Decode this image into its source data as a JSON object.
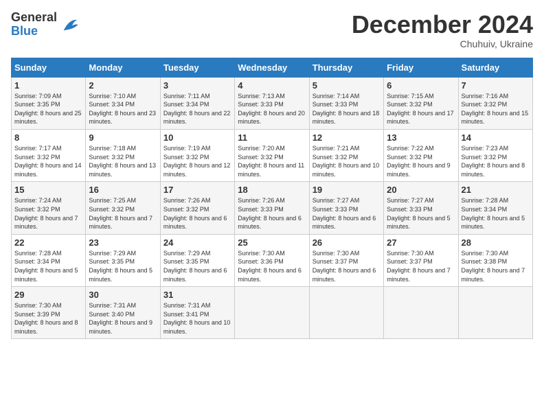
{
  "logo": {
    "general": "General",
    "blue": "Blue"
  },
  "header": {
    "title": "December 2024",
    "subtitle": "Chuhuiv, Ukraine"
  },
  "columns": [
    "Sunday",
    "Monday",
    "Tuesday",
    "Wednesday",
    "Thursday",
    "Friday",
    "Saturday"
  ],
  "weeks": [
    [
      {
        "day": "1",
        "sunrise": "7:09 AM",
        "sunset": "3:35 PM",
        "daylight": "8 hours and 25 minutes."
      },
      {
        "day": "2",
        "sunrise": "7:10 AM",
        "sunset": "3:34 PM",
        "daylight": "8 hours and 23 minutes."
      },
      {
        "day": "3",
        "sunrise": "7:11 AM",
        "sunset": "3:34 PM",
        "daylight": "8 hours and 22 minutes."
      },
      {
        "day": "4",
        "sunrise": "7:13 AM",
        "sunset": "3:33 PM",
        "daylight": "8 hours and 20 minutes."
      },
      {
        "day": "5",
        "sunrise": "7:14 AM",
        "sunset": "3:33 PM",
        "daylight": "8 hours and 18 minutes."
      },
      {
        "day": "6",
        "sunrise": "7:15 AM",
        "sunset": "3:32 PM",
        "daylight": "8 hours and 17 minutes."
      },
      {
        "day": "7",
        "sunrise": "7:16 AM",
        "sunset": "3:32 PM",
        "daylight": "8 hours and 15 minutes."
      }
    ],
    [
      {
        "day": "8",
        "sunrise": "7:17 AM",
        "sunset": "3:32 PM",
        "daylight": "8 hours and 14 minutes."
      },
      {
        "day": "9",
        "sunrise": "7:18 AM",
        "sunset": "3:32 PM",
        "daylight": "8 hours and 13 minutes."
      },
      {
        "day": "10",
        "sunrise": "7:19 AM",
        "sunset": "3:32 PM",
        "daylight": "8 hours and 12 minutes."
      },
      {
        "day": "11",
        "sunrise": "7:20 AM",
        "sunset": "3:32 PM",
        "daylight": "8 hours and 11 minutes."
      },
      {
        "day": "12",
        "sunrise": "7:21 AM",
        "sunset": "3:32 PM",
        "daylight": "8 hours and 10 minutes."
      },
      {
        "day": "13",
        "sunrise": "7:22 AM",
        "sunset": "3:32 PM",
        "daylight": "8 hours and 9 minutes."
      },
      {
        "day": "14",
        "sunrise": "7:23 AM",
        "sunset": "3:32 PM",
        "daylight": "8 hours and 8 minutes."
      }
    ],
    [
      {
        "day": "15",
        "sunrise": "7:24 AM",
        "sunset": "3:32 PM",
        "daylight": "8 hours and 7 minutes."
      },
      {
        "day": "16",
        "sunrise": "7:25 AM",
        "sunset": "3:32 PM",
        "daylight": "8 hours and 7 minutes."
      },
      {
        "day": "17",
        "sunrise": "7:26 AM",
        "sunset": "3:32 PM",
        "daylight": "8 hours and 6 minutes."
      },
      {
        "day": "18",
        "sunrise": "7:26 AM",
        "sunset": "3:33 PM",
        "daylight": "8 hours and 6 minutes."
      },
      {
        "day": "19",
        "sunrise": "7:27 AM",
        "sunset": "3:33 PM",
        "daylight": "8 hours and 6 minutes."
      },
      {
        "day": "20",
        "sunrise": "7:27 AM",
        "sunset": "3:33 PM",
        "daylight": "8 hours and 5 minutes."
      },
      {
        "day": "21",
        "sunrise": "7:28 AM",
        "sunset": "3:34 PM",
        "daylight": "8 hours and 5 minutes."
      }
    ],
    [
      {
        "day": "22",
        "sunrise": "7:28 AM",
        "sunset": "3:34 PM",
        "daylight": "8 hours and 5 minutes."
      },
      {
        "day": "23",
        "sunrise": "7:29 AM",
        "sunset": "3:35 PM",
        "daylight": "8 hours and 5 minutes."
      },
      {
        "day": "24",
        "sunrise": "7:29 AM",
        "sunset": "3:35 PM",
        "daylight": "8 hours and 6 minutes."
      },
      {
        "day": "25",
        "sunrise": "7:30 AM",
        "sunset": "3:36 PM",
        "daylight": "8 hours and 6 minutes."
      },
      {
        "day": "26",
        "sunrise": "7:30 AM",
        "sunset": "3:37 PM",
        "daylight": "8 hours and 6 minutes."
      },
      {
        "day": "27",
        "sunrise": "7:30 AM",
        "sunset": "3:37 PM",
        "daylight": "8 hours and 7 minutes."
      },
      {
        "day": "28",
        "sunrise": "7:30 AM",
        "sunset": "3:38 PM",
        "daylight": "8 hours and 7 minutes."
      }
    ],
    [
      {
        "day": "29",
        "sunrise": "7:30 AM",
        "sunset": "3:39 PM",
        "daylight": "8 hours and 8 minutes."
      },
      {
        "day": "30",
        "sunrise": "7:31 AM",
        "sunset": "3:40 PM",
        "daylight": "8 hours and 9 minutes."
      },
      {
        "day": "31",
        "sunrise": "7:31 AM",
        "sunset": "3:41 PM",
        "daylight": "8 hours and 10 minutes."
      },
      null,
      null,
      null,
      null
    ]
  ]
}
